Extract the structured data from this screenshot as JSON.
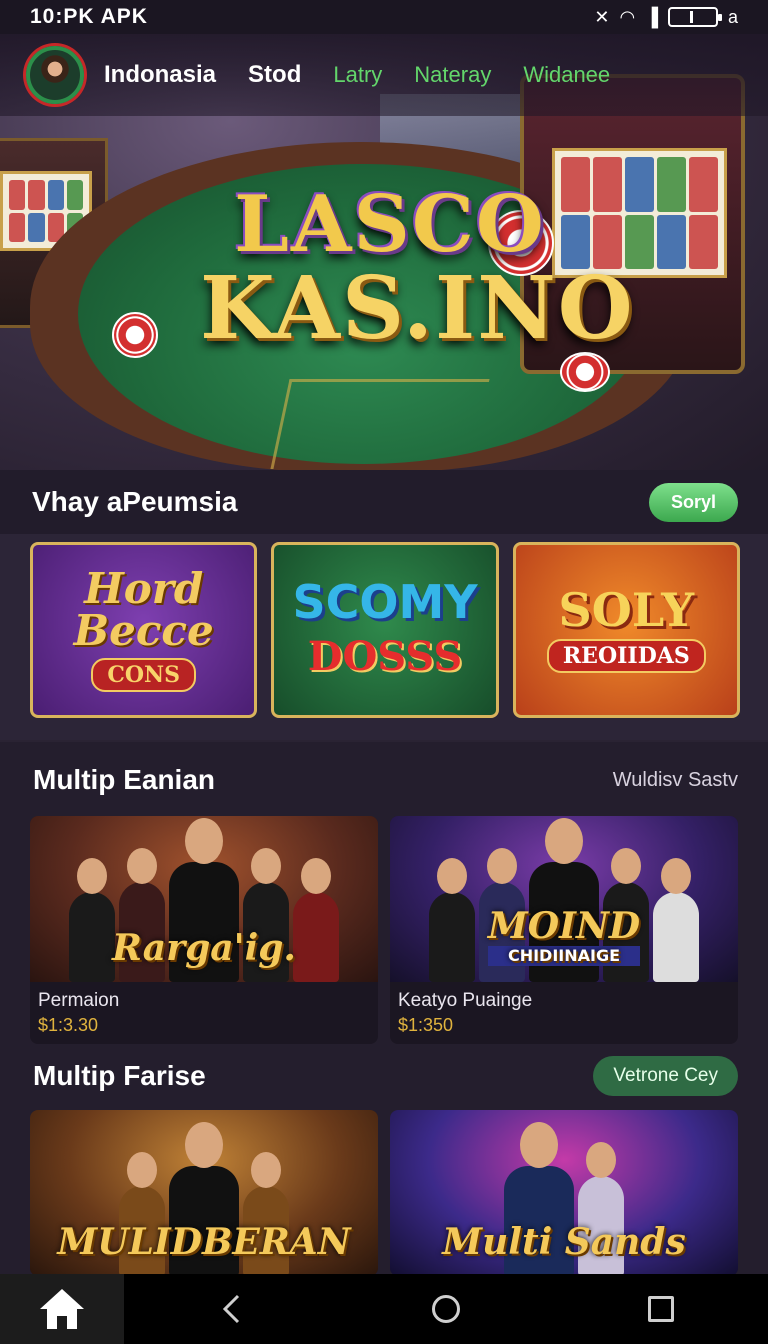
{
  "status_bar": {
    "time": "10:PK APK",
    "icons": [
      "notification-off-icon",
      "wifi-icon",
      "signal-icon",
      "battery-icon"
    ],
    "battery_suffix": "a"
  },
  "nav": {
    "items": [
      {
        "label": "Indonasia",
        "style": "primary"
      },
      {
        "label": "Stod",
        "style": "primary"
      },
      {
        "label": "Latry",
        "style": "accent"
      },
      {
        "label": "Nateray",
        "style": "accent"
      },
      {
        "label": "Widanee",
        "style": "accent"
      }
    ]
  },
  "hero": {
    "logo_line1": "LASCO",
    "logo_line2": "KAS.INO"
  },
  "section1": {
    "title": "Vhay aPeumsia",
    "button": "Soryl",
    "promos": [
      {
        "title": "Hord Becce",
        "subtitle": "CONS"
      },
      {
        "title": "SCOMY",
        "subtitle": "DOSSS"
      },
      {
        "title": "SOLY",
        "subtitle": "REOIIDAS"
      }
    ]
  },
  "section2": {
    "title": "Multip Eanian",
    "link": "Wuldisv Sastv",
    "games": [
      {
        "logo": "Rarga'ig.",
        "logo_sub": "",
        "name": "Permaion",
        "price": "$1:3.30"
      },
      {
        "logo": "MOIND",
        "logo_sub": "CHIDIINAIGE",
        "name": "Keatyo Puainge",
        "price": "$1:350"
      }
    ]
  },
  "section3": {
    "title": "Multip Farise",
    "button": "Vetrone Cey",
    "games": [
      {
        "logo": "MULIDBERAN"
      },
      {
        "logo": "Multi Sands"
      }
    ]
  },
  "theme": {
    "background": "#2a2333",
    "accent_green": "#63d66b",
    "gold": "#e0b33e"
  }
}
